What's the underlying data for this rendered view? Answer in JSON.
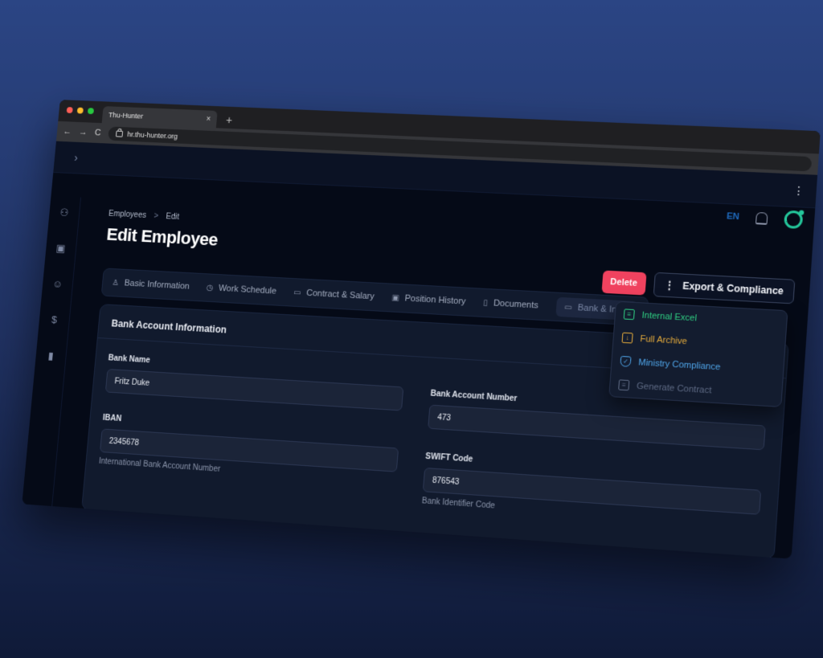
{
  "browser": {
    "tab_title": "Thu-Hunter",
    "tab_close": "×",
    "new_tab": "+",
    "url": "hr.thu-hunter.org",
    "back": "←",
    "forward": "→",
    "reload": "C"
  },
  "app": {
    "language": "EN"
  },
  "breadcrumb": {
    "root": "Employees",
    "separator": ">",
    "current": "Edit"
  },
  "page_title": "Edit Employee",
  "actions": {
    "delete_label": "Delete",
    "export_label": "Export & Compliance",
    "export_icon": "⋮"
  },
  "export_menu": {
    "items": [
      {
        "label": "Internal Excel",
        "icon": "spreadsheet-icon",
        "color": "#2fcf83"
      },
      {
        "label": "Full Archive",
        "icon": "archive-icon",
        "color": "#e2a93b"
      },
      {
        "label": "Ministry Compliance",
        "icon": "shield-icon",
        "color": "#4fa5e9"
      },
      {
        "label": "Generate Contract",
        "icon": "document-icon",
        "color": "#5e6a84"
      }
    ]
  },
  "tabs": [
    {
      "label": "Basic Information",
      "icon": "user-icon"
    },
    {
      "label": "Work Schedule",
      "icon": "clock-icon"
    },
    {
      "label": "Contract & Salary",
      "icon": "money-icon"
    },
    {
      "label": "Position History",
      "icon": "briefcase-icon"
    },
    {
      "label": "Documents",
      "icon": "file-icon"
    },
    {
      "label": "Bank & Integ",
      "icon": "bank-icon",
      "active": true
    }
  ],
  "card": {
    "title": "Bank Account Information",
    "fields": {
      "bank_name": {
        "label": "Bank Name",
        "value": "Fritz Duke"
      },
      "bank_account_number": {
        "label": "Bank Account Number",
        "value": "473"
      },
      "iban": {
        "label": "IBAN",
        "value": "2345678",
        "help": "International Bank Account Number"
      },
      "swift": {
        "label": "SWIFT Code",
        "value": "876543",
        "help": "Bank Identifier Code"
      }
    }
  }
}
